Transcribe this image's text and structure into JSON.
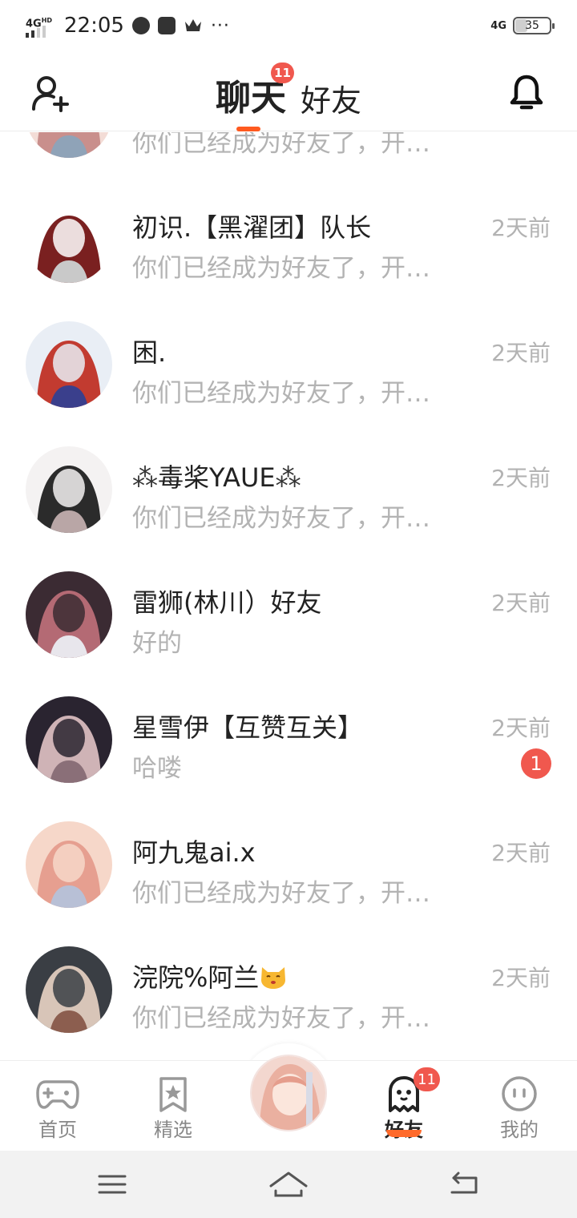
{
  "status_bar": {
    "network_label": "4G",
    "network_sub": "HD",
    "time": "22:05",
    "more": "···",
    "right_network": "4G",
    "battery": "35"
  },
  "header": {
    "tabs": [
      {
        "label": "聊天",
        "badge": "11",
        "active": true
      },
      {
        "label": "好友",
        "active": false
      }
    ],
    "left_icon": "add-friend-icon",
    "right_icon": "bell-icon"
  },
  "conversations": [
    {
      "name": "",
      "message": "你们已经成为好友了，开…",
      "time": "",
      "avatar_colors": [
        "#f3dcd6",
        "#c98f8c",
        "#8fa3b8"
      ]
    },
    {
      "name": "初识.【黑濯团】队长",
      "message": "你们已经成为好友了，开…",
      "time": "2天前",
      "avatar_colors": [
        "#ffffff",
        "#7a2020",
        "#c9c9c9"
      ]
    },
    {
      "name": "困.",
      "message": "你们已经成为好友了，开…",
      "time": "2天前",
      "avatar_colors": [
        "#e9eef5",
        "#c23b30",
        "#3a3f8c"
      ]
    },
    {
      "name": "毒桨YAUE",
      "message": "你们已经成为好友了，开…",
      "time": "2天前",
      "avatar_colors": [
        "#f4f2f2",
        "#2b2b2b",
        "#b9a6a6"
      ],
      "decorated": true
    },
    {
      "name": "雷狮(林川）好友",
      "message": "好的",
      "time": "2天前",
      "avatar_colors": [
        "#3b2b33",
        "#b46a74",
        "#e8e6ec"
      ]
    },
    {
      "name": "星雪伊【互赞互关】",
      "message": "哈喽",
      "time": "2天前",
      "unread": "1",
      "avatar_colors": [
        "#2a2430",
        "#cfb3b6",
        "#8a6f78"
      ]
    },
    {
      "name": "阿九鬼ai.x",
      "message": "你们已经成为好友了，开…",
      "time": "2天前",
      "avatar_colors": [
        "#f6d7c9",
        "#e69f90",
        "#b8c0d6"
      ]
    },
    {
      "name": "浣院%阿兰",
      "message": "你们已经成为好友了，开…",
      "time": "2天前",
      "avatar_colors": [
        "#3a3e44",
        "#d8c5b8",
        "#8c5e4f"
      ],
      "emoji": "cat-face-icon"
    }
  ],
  "bottom_nav": {
    "items": [
      {
        "label": "首页",
        "icon": "gamepad-icon"
      },
      {
        "label": "精选",
        "icon": "star-bookmark-icon"
      },
      {
        "label": "",
        "icon": "center-avatar"
      },
      {
        "label": "好友",
        "icon": "ghost-icon",
        "badge": "11",
        "active": true
      },
      {
        "label": "我的",
        "icon": "smile-face-icon"
      }
    ]
  },
  "system_nav": {
    "buttons": [
      "menu-icon",
      "home-icon",
      "back-icon"
    ]
  },
  "colors": {
    "accent": "#ff5a1f",
    "badge": "#f0584e",
    "secondary_text": "#b3b3b3"
  }
}
